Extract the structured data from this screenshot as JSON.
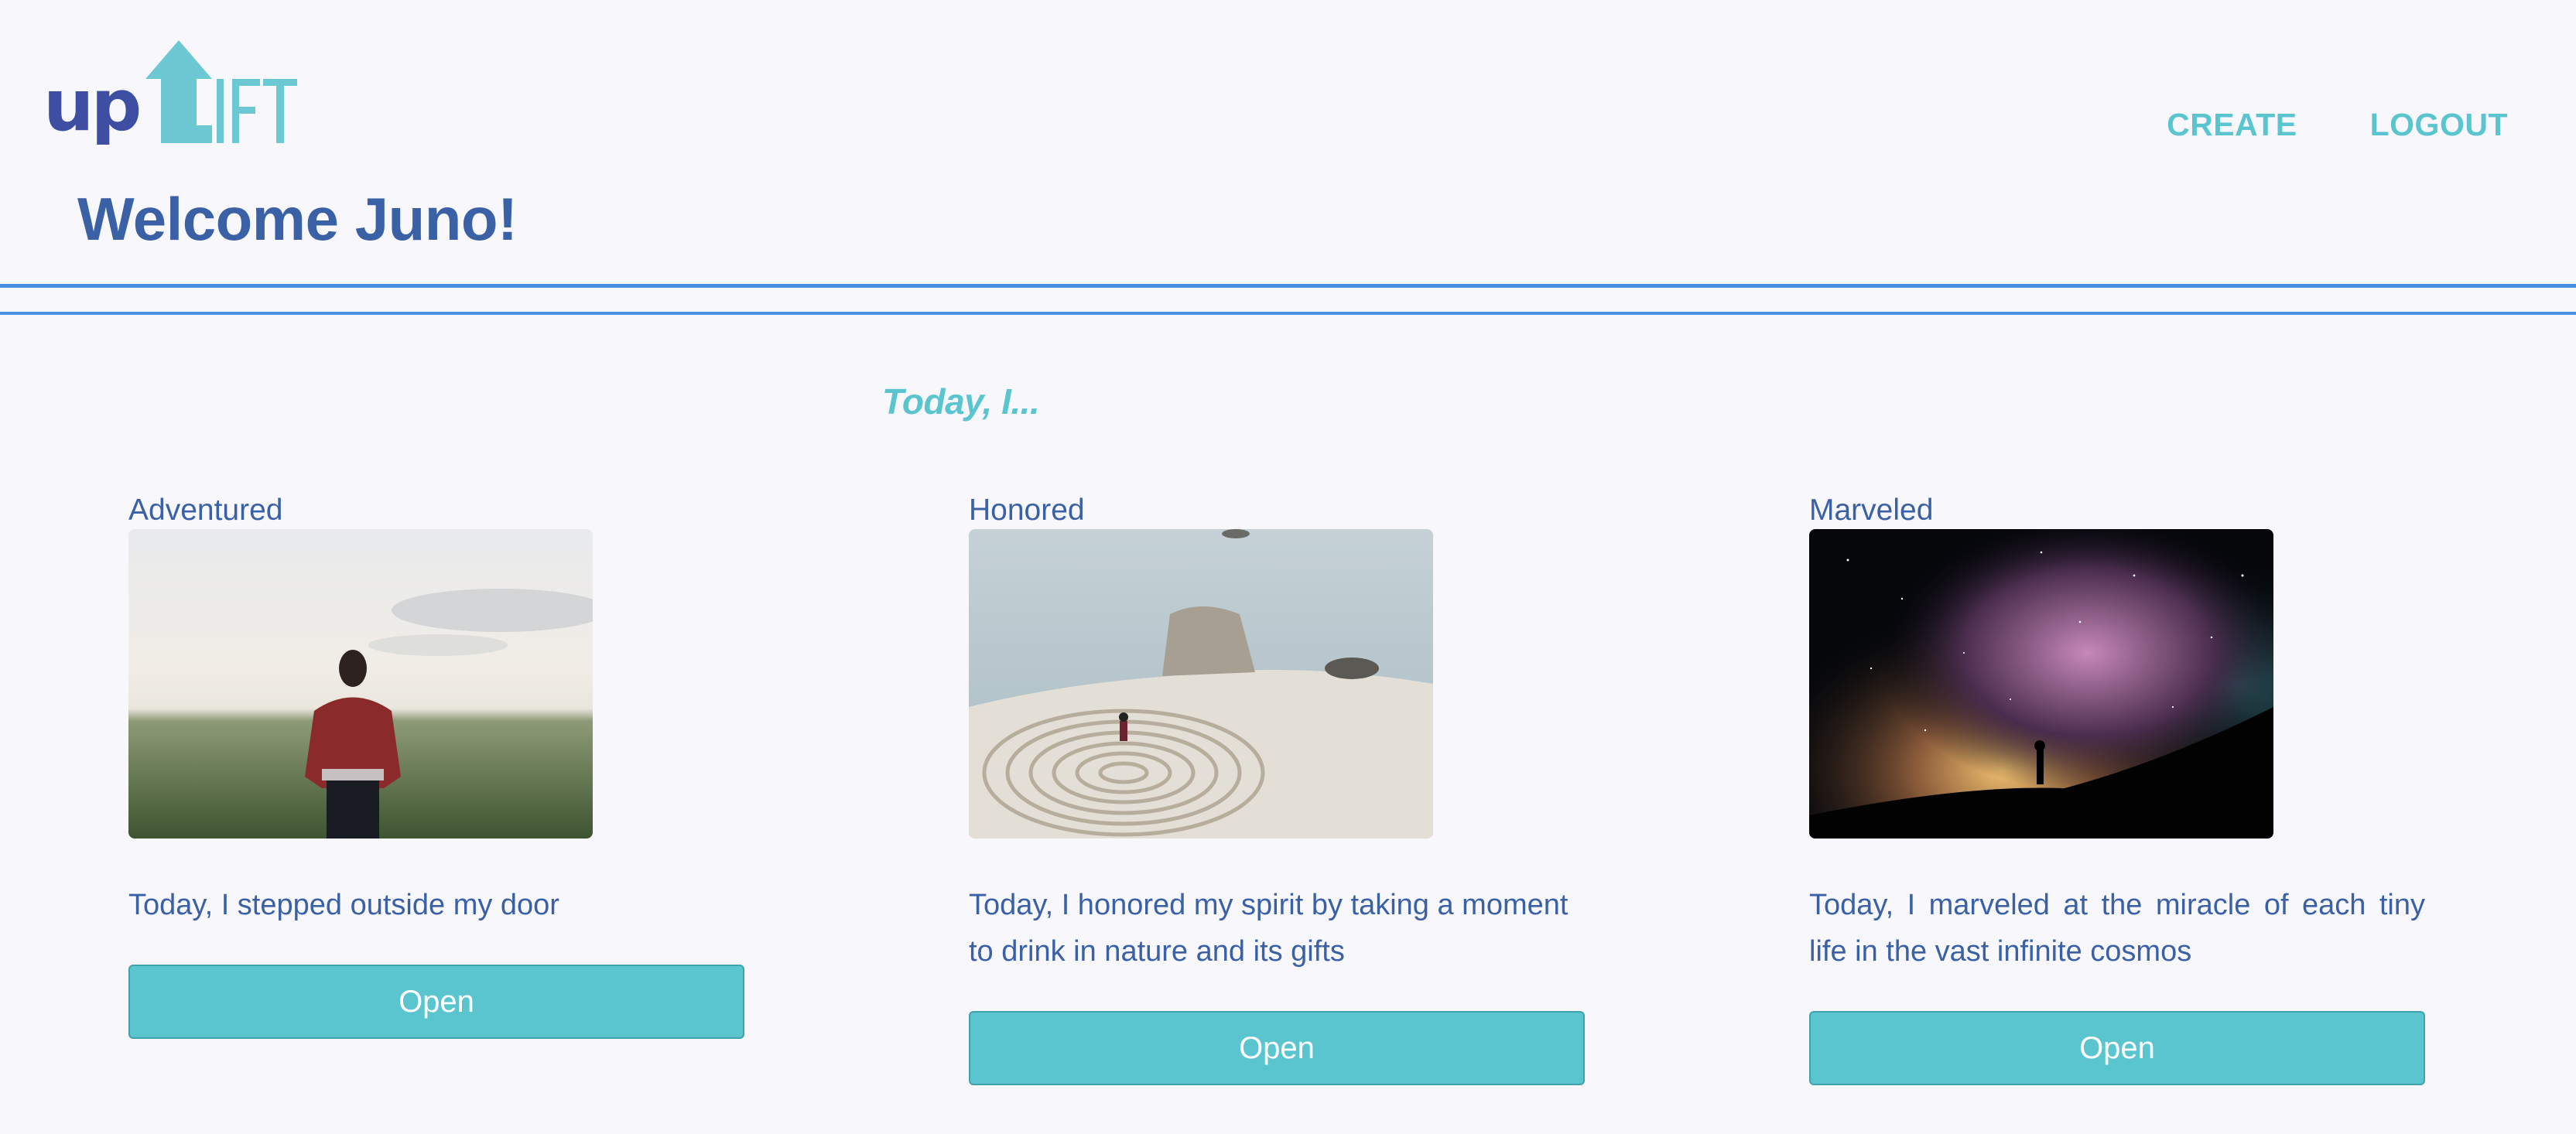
{
  "header": {
    "logo_text": "upLIFT",
    "welcome": "Welcome Juno!",
    "nav": {
      "create": "CREATE",
      "logout": "LOGOUT"
    }
  },
  "main": {
    "tagline": "Today, I...",
    "cards": [
      {
        "title": "Adventured",
        "image": "person-in-red-jacket-on-foggy-field",
        "description": "Today, I stepped outside my door",
        "button": "Open"
      },
      {
        "title": "Honored",
        "image": "stone-labyrinth-on-sea-cliff",
        "description": "Today, I honored my spirit by taking a moment to drink in nature and its gifts",
        "button": "Open"
      },
      {
        "title": "Marveled",
        "image": "silhouette-under-milky-way",
        "description": "Today, I marveled at the miracle of each tiny life in the vast infinite cosmos",
        "button": "Open"
      }
    ]
  },
  "colors": {
    "background": "#f8f8fc",
    "primary_blue": "#3a60a6",
    "accent_teal": "#5bc5cf",
    "rule_blue": "#4a90e2",
    "logo_navy": "#3e4fa3"
  }
}
